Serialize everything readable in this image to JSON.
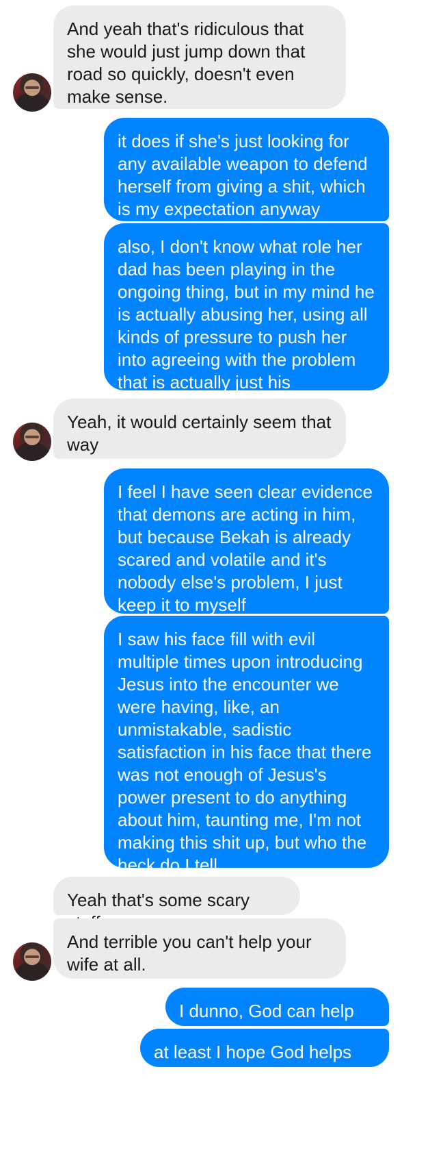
{
  "conversation": {
    "messages": [
      {
        "sender": "them",
        "text": "And yeah that's ridiculous that she would just jump down that road so quickly, doesn't even make sense."
      },
      {
        "sender": "me",
        "text": "it does if she's just looking for any available weapon to defend herself from giving a shit, which is my expectation anyway"
      },
      {
        "sender": "me",
        "text": "also, I don't know what role her dad has been playing in the ongoing thing, but in my mind he is actually abusing her, using all kinds of pressure to push her into agreeing with the problem that is actually just his"
      },
      {
        "sender": "them",
        "text": "Yeah, it would certainly seem that way"
      },
      {
        "sender": "me",
        "text": "I feel I have seen clear evidence that demons are acting in him, but because Bekah is already scared and volatile and it's nobody else's problem, I just keep it to myself"
      },
      {
        "sender": "me",
        "text": "I saw his face fill with evil multiple times upon introducing Jesus into the encounter we were having, like, an unmistakable, sadistic satisfaction in his face that there was not enough of Jesus's power present to do anything about him, taunting me, I'm not making this shit up, but who the heck do I tell"
      },
      {
        "sender": "them",
        "text": "Yeah that's some scary stuff"
      },
      {
        "sender": "them",
        "text": "And terrible you can't help your wife at all."
      },
      {
        "sender": "me",
        "text": "I dunno, God can help her"
      },
      {
        "sender": "me",
        "text": "at least I hope God helps her"
      }
    ]
  },
  "colors": {
    "outgoing_bubble": "#0084ff",
    "incoming_bubble": "#ebebeb",
    "outgoing_text": "#ffffff",
    "incoming_text": "#1a1a1a"
  }
}
